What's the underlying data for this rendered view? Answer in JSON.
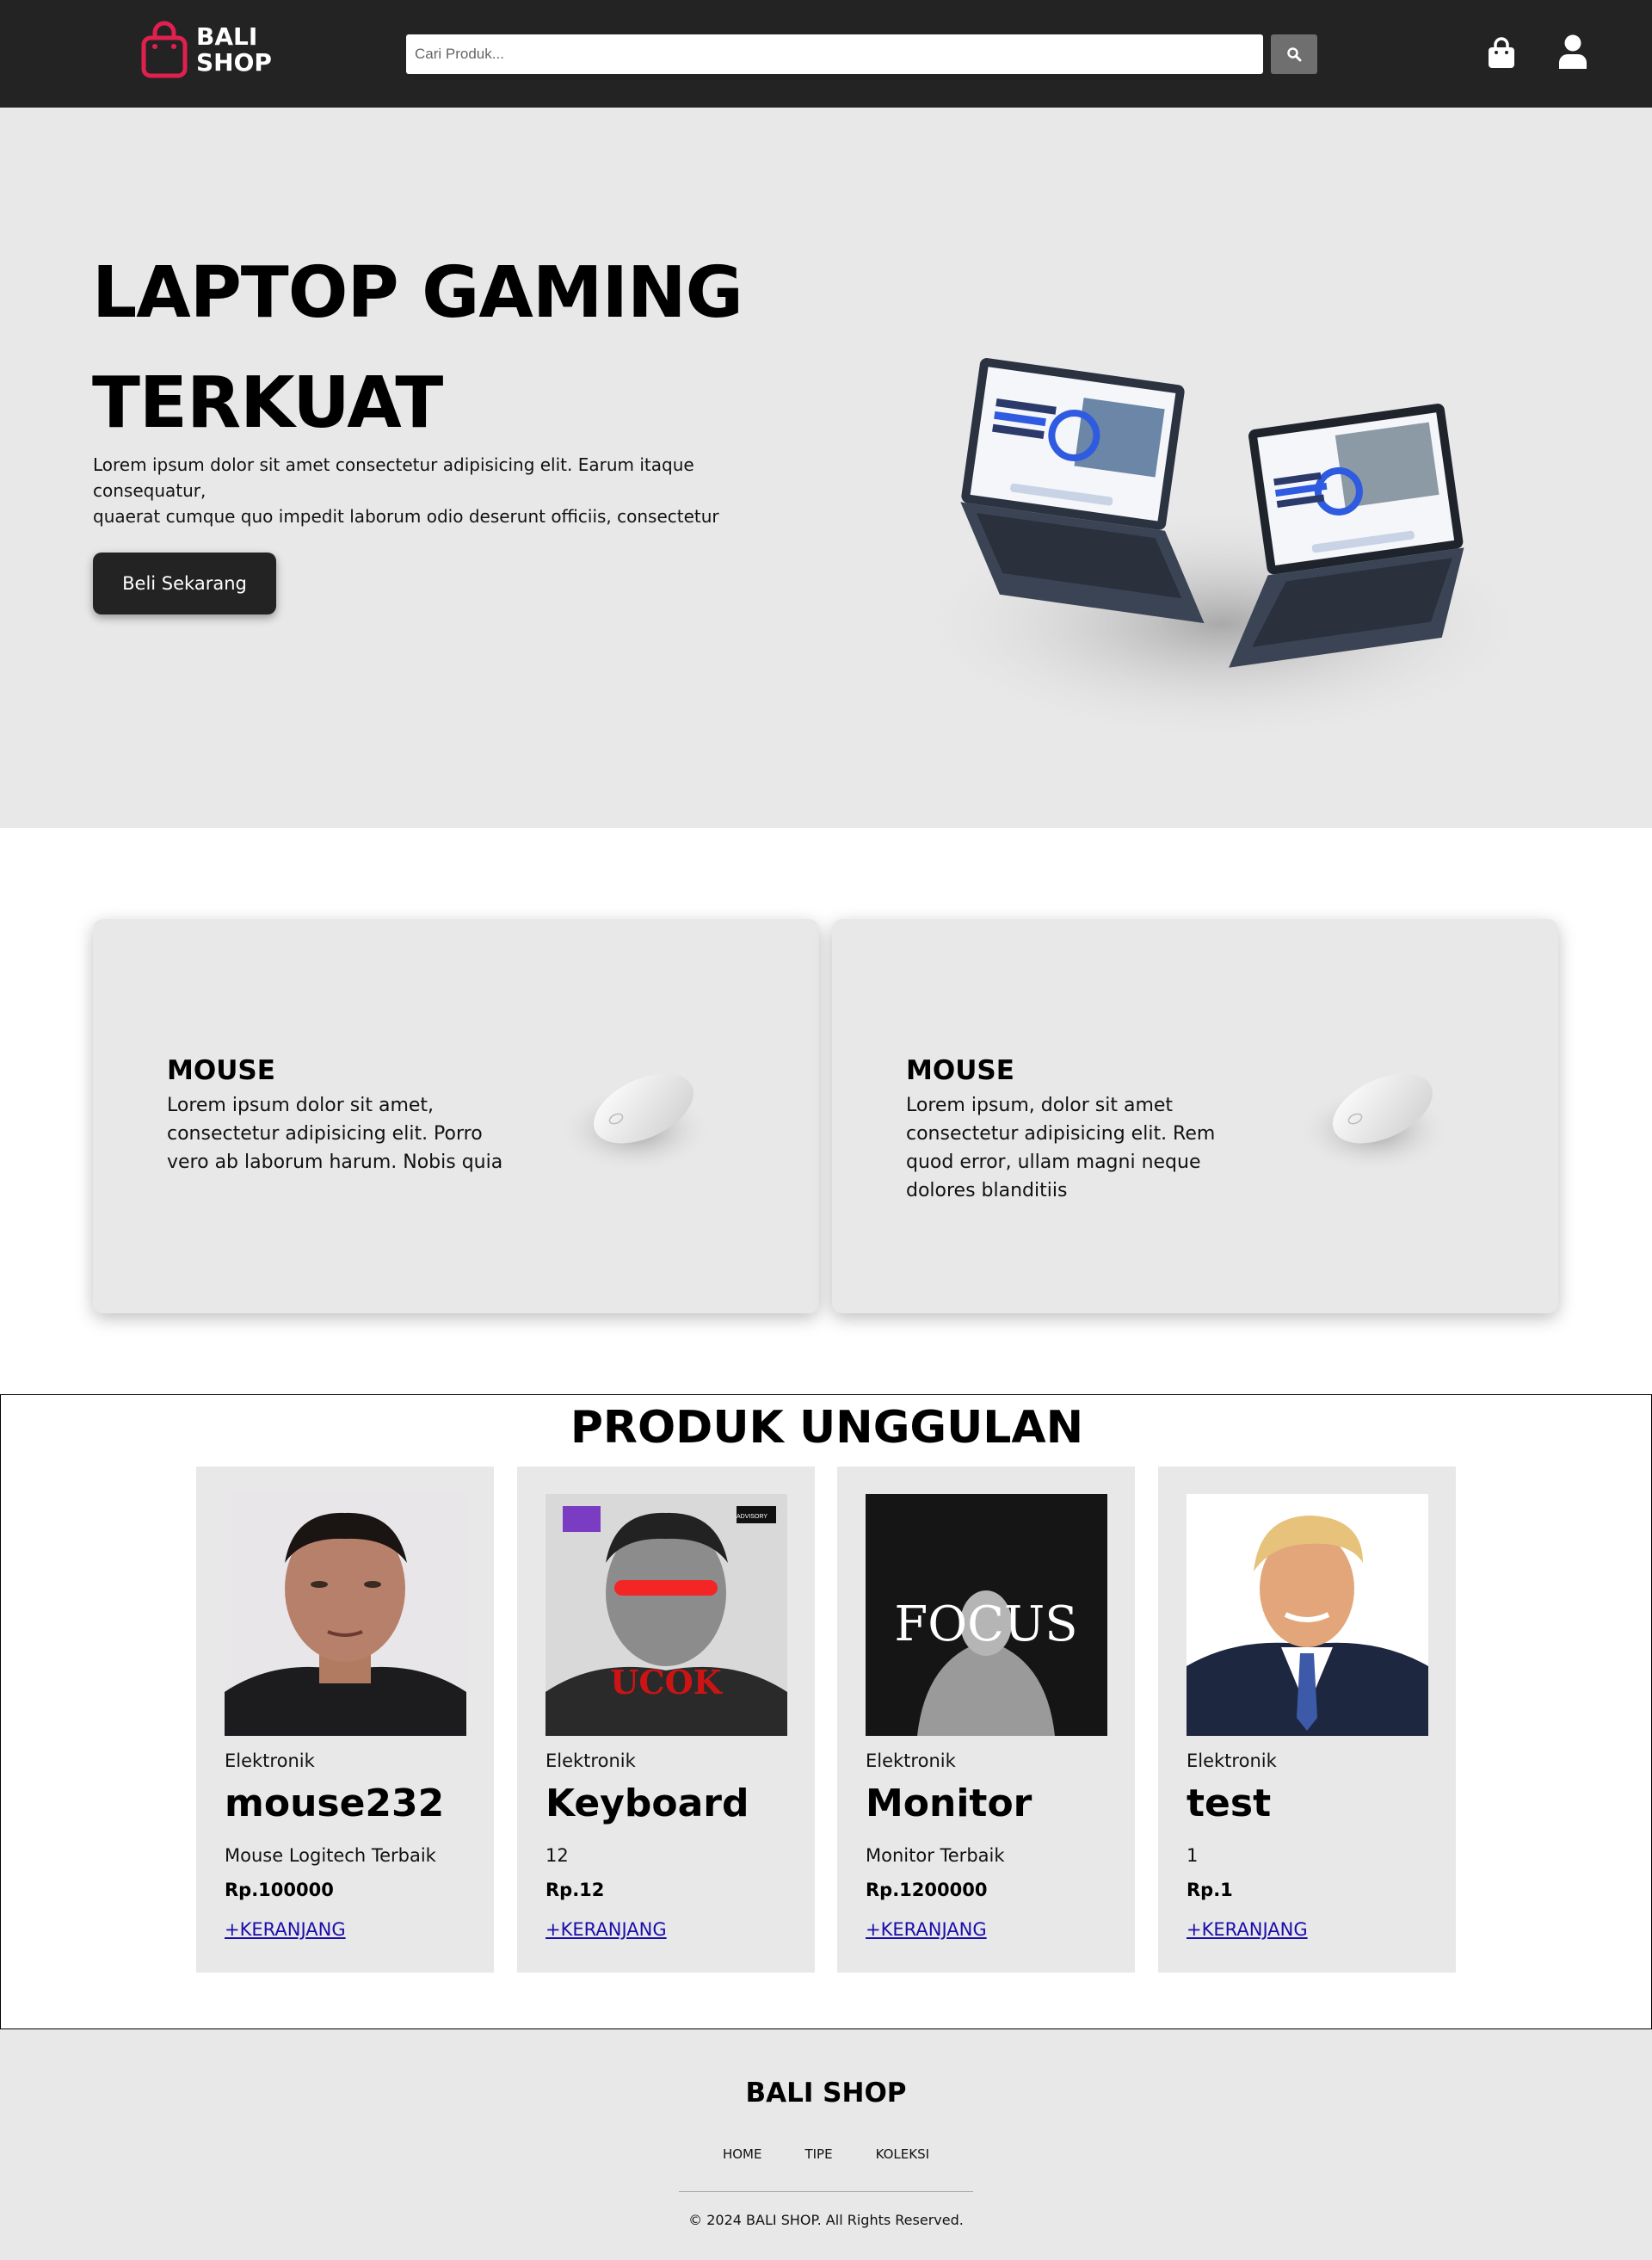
{
  "colors": {
    "navbar_bg": "#232323",
    "accent_logo": "#e0204f",
    "hero_bg": "#e8e8e8",
    "button_bg": "#232323",
    "link": "#1a0dab"
  },
  "navbar": {
    "logo_line1": "BALI",
    "logo_line2": "SHOP",
    "logo_icon": "shopping-bag-icon",
    "search_placeholder": "Cari Produk...",
    "search_icon": "search-icon",
    "cart_icon": "shopping-bag-icon",
    "user_icon": "user-icon"
  },
  "hero": {
    "title": "LAPTOP GAMING TERKUAT",
    "description_line1": "Lorem ipsum dolor sit amet consectetur adipisicing elit. Earum itaque consequatur,",
    "description_line2": "quaerat cumque quo impedit laborum odio deserunt officiis, consectetur",
    "button_label": "Beli Sekarang"
  },
  "features": [
    {
      "title": "MOUSE",
      "text": "Lorem ipsum dolor sit amet, consectetur adipisicing elit. Porro vero ab laborum harum. Nobis quia"
    },
    {
      "title": "MOUSE",
      "text": "Lorem ipsum, dolor sit amet consectetur adipisicing elit. Rem quod error, ullam magni neque dolores blanditiis"
    }
  ],
  "products": {
    "section_title": "PRODUK UNGGULAN",
    "items": [
      {
        "category": "Elektronik",
        "name": "mouse232",
        "description": "Mouse Logitech Terbaik",
        "price": "Rp.100000",
        "cart_label": "+KERANJANG"
      },
      {
        "category": "Elektronik",
        "name": "Keyboard",
        "description": "12",
        "price": "Rp.12",
        "cart_label": "+KERANJANG",
        "image_text": "UCOK"
      },
      {
        "category": "Elektronik",
        "name": "Monitor",
        "description": "Monitor Terbaik",
        "price": "Rp.1200000",
        "cart_label": "+KERANJANG",
        "image_text": "FOCUS"
      },
      {
        "category": "Elektronik",
        "name": "test",
        "description": "1",
        "price": "Rp.1",
        "cart_label": "+KERANJANG"
      }
    ]
  },
  "footer": {
    "brand": "BALI SHOP",
    "nav": [
      "HOME",
      "TIPE",
      "KOLEKSI"
    ],
    "copyright": "© 2024 BALI SHOP. All Rights Reserved."
  }
}
